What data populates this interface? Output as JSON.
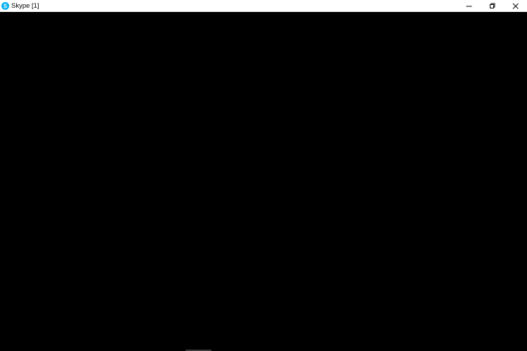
{
  "window": {
    "title": "Skype [1]",
    "icon": "skype-icon",
    "controls": {
      "minimize_icon": "minimize-icon",
      "restore_icon": "restore-icon",
      "close_icon": "close-icon"
    }
  },
  "colors": {
    "titlebar_bg": "#ffffff",
    "content_bg": "#000000",
    "skype_blue": "#00aff0"
  }
}
